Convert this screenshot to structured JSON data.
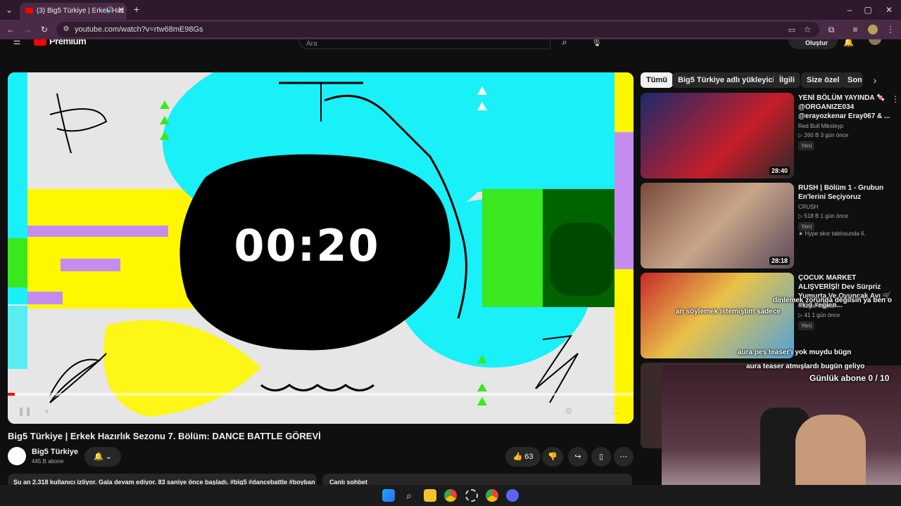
{
  "browser": {
    "tab_title": "(3) Big5 Türkiye | Erkek Haz",
    "new_tab": "+",
    "url": "youtube.com/watch?v=rtw68mE98Gs"
  },
  "youtube": {
    "logo": "Premium",
    "search_placeholder": "Ara",
    "create_label": "Oluştur"
  },
  "video": {
    "timer": "00:20",
    "title": "Big5 Türkiye | Erkek Hazırlık Sezonu 7. Bölüm: DANCE BATTLE GÖREVİ",
    "channel": "Big5 Türkiye",
    "subscribers": "445 B abone",
    "likes": "63",
    "description_preview": "Şu an 2.318 kullanıcı izliyor. Gala devam ediyor. 83 saniye önce başladı. #big5 #dancebattle #boyban",
    "live_chat": "Canlı sohbet"
  },
  "chips": [
    "Tümü",
    "Big5 Türkiye adlı yükleyiciden",
    "İlgili",
    "Size özel",
    "Son"
  ],
  "recommendations": [
    {
      "title": "YENİ BÖLÜM YAYINDA 🍬 @ORGANIZE034 @erayozkenar Eray067 & ...",
      "channel": "Red Bull Mikstеyp",
      "meta": "▷ 260 B  3 gün önce",
      "badge": "Yeni",
      "extra": "",
      "duration": "28:40"
    },
    {
      "title": "RUSH | Bölüm 1 - Grubun En'lerini Seçiyoruz",
      "channel": "CRUSH",
      "meta": "▷ 518 B  1 gün önce",
      "badge": "Yeni",
      "extra": "★ Hype skor tablosunda 6.",
      "duration": "28:18"
    },
    {
      "title": "ÇOCUK MARKET ALIŞVERİŞİ! Dev Sürpriz Yumurta Ve Oyuncak Avı 🛒 #kid #eğlen...",
      "channel": "Rüzgar Keşifte",
      "meta": "▷ 41  1 gün önce",
      "badge": "Yeni",
      "extra": "",
      "duration": ""
    }
  ],
  "overlay": {
    "chat1": "dinlemek zorunda değilsin ya ben o",
    "chat2": "an söylemek istemiştim sadece",
    "chat3": "aura peş teaser'ı yok muydu bügn",
    "chat4": "aura teaser atmışlardı bugün geliyo",
    "goal": "Günlük abone 0 / 10"
  },
  "colors": {
    "accent": "#ff0000",
    "cyan": "#19f0f8",
    "yellow": "#fff700",
    "purple": "#c58cf0",
    "green": "#39e81f"
  }
}
